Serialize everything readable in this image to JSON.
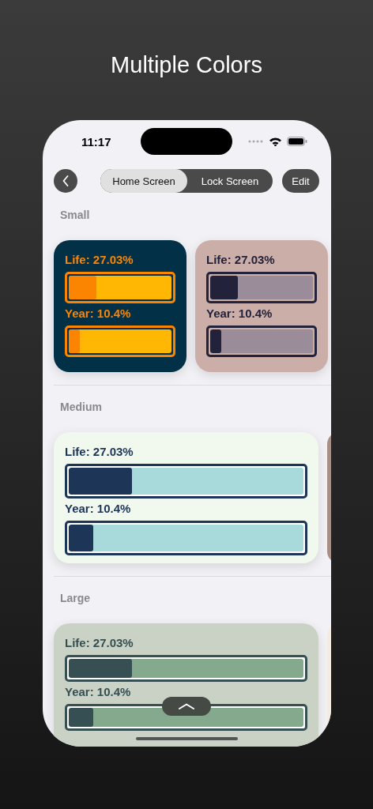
{
  "page_title": "Multiple Colors",
  "status_bar": {
    "time": "11:17"
  },
  "nav": {
    "segments": [
      {
        "label": "Home Screen",
        "selected": true
      },
      {
        "label": "Lock Screen",
        "selected": false
      }
    ],
    "edit": "Edit"
  },
  "sections": [
    {
      "title": "Small",
      "kind": "small",
      "widgets": [
        {
          "kind": "widget",
          "color": "#023047",
          "text": {
            "color": "#fb8500"
          },
          "frame": {
            "color": "#fb8500"
          },
          "track": {
            "color": "#ffb703"
          },
          "fill": {
            "color": "#fb8500"
          },
          "bars": [
            {
              "label": "Life: 27.03%",
              "level": 0.2703
            },
            {
              "label": "Year: 10.4%",
              "level": 0.104
            }
          ]
        },
        {
          "kind": "widget",
          "color": "#cbaea8",
          "text": {
            "color": "#22223b"
          },
          "frame": {
            "color": "#22223b"
          },
          "track": {
            "color": "#9a8c98"
          },
          "fill": {
            "color": "#22223b"
          },
          "bars": [
            {
              "label": "Life: 27.03%",
              "level": 0.2703
            },
            {
              "label": "Year: 10.4%",
              "level": 0.104
            }
          ]
        }
      ]
    },
    {
      "title": "Medium",
      "kind": "medium",
      "widgets": [
        {
          "kind": "widget",
          "color": "#f1f8ee",
          "text": {
            "color": "#1d3557"
          },
          "frame": {
            "color": "#1d3557"
          },
          "track": {
            "color": "#a8dadc"
          },
          "fill": {
            "color": "#1d3557"
          },
          "bars": [
            {
              "label": "Life: 27.03%",
              "level": 0.2703
            },
            {
              "label": "Year: 10.4%",
              "level": 0.104
            }
          ]
        },
        {
          "kind": "peek",
          "color": "#a88f86"
        }
      ]
    },
    {
      "title": "Large",
      "kind": "large",
      "widgets": [
        {
          "kind": "widget",
          "color": "#cad2c5",
          "text": {
            "color": "#354f52"
          },
          "frame": {
            "color": "#354f52"
          },
          "track": {
            "color": "#84a98c"
          },
          "fill": {
            "color": "#354f52"
          },
          "bars": [
            {
              "label": "Life: 27.03%",
              "level": 0.2703
            },
            {
              "label": "Year: 10.4%",
              "level": 0.104
            }
          ]
        },
        {
          "kind": "peek",
          "color": "#f4ece2"
        }
      ]
    }
  ]
}
